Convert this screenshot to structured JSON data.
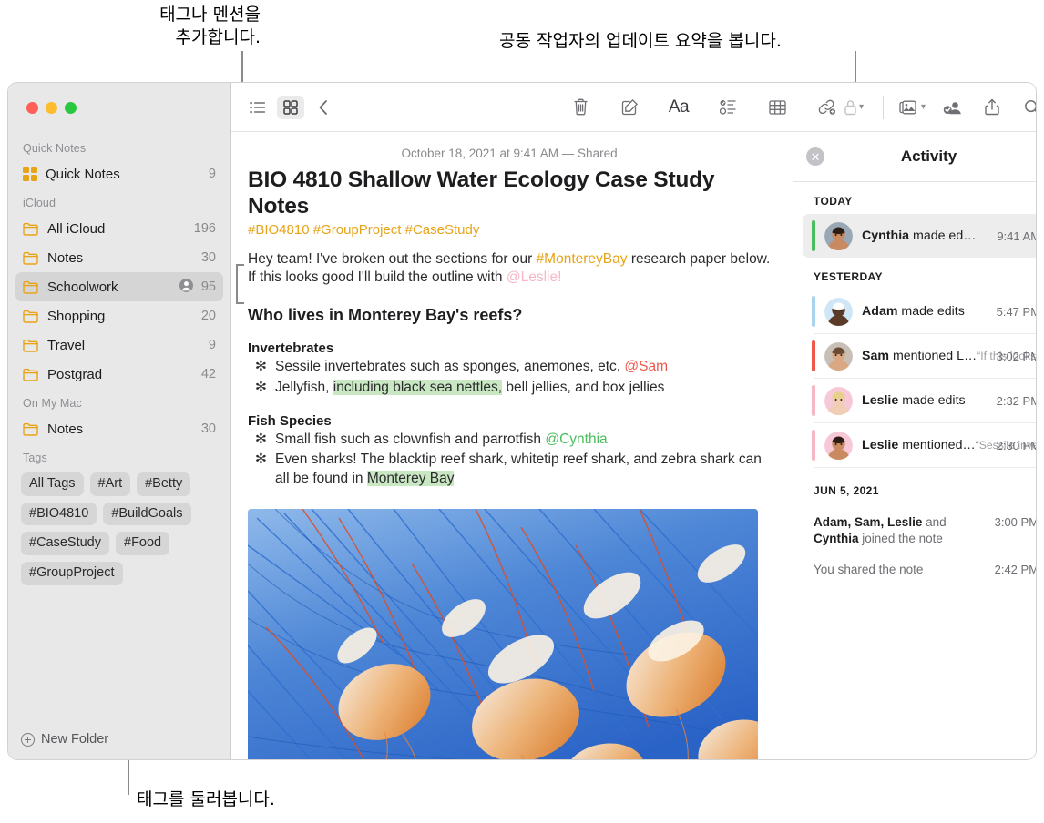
{
  "annotations": {
    "top_left": "태그나 멘션을\n추가합니다.",
    "top_right": "공동 작업자의 업데이트 요약을 봅니다.",
    "bottom_left": "태그를 둘러봅니다."
  },
  "sidebar": {
    "groups": [
      {
        "title": "Quick Notes",
        "items": [
          {
            "label": "Quick Notes",
            "count": "9",
            "icon": "quicknotes-icon",
            "selected": false,
            "shared": false
          }
        ]
      },
      {
        "title": "iCloud",
        "items": [
          {
            "label": "All iCloud",
            "count": "196",
            "icon": "folder-icon",
            "selected": false,
            "shared": false
          },
          {
            "label": "Notes",
            "count": "30",
            "icon": "folder-icon",
            "selected": false,
            "shared": false
          },
          {
            "label": "Schoolwork",
            "count": "95",
            "icon": "folder-icon",
            "selected": true,
            "shared": true
          },
          {
            "label": "Shopping",
            "count": "20",
            "icon": "folder-icon",
            "selected": false,
            "shared": false
          },
          {
            "label": "Travel",
            "count": "9",
            "icon": "folder-icon",
            "selected": false,
            "shared": false
          },
          {
            "label": "Postgrad",
            "count": "42",
            "icon": "folder-icon",
            "selected": false,
            "shared": false
          }
        ]
      },
      {
        "title": "On My Mac",
        "items": [
          {
            "label": "Notes",
            "count": "30",
            "icon": "folder-icon",
            "selected": false,
            "shared": false
          }
        ]
      }
    ],
    "tags_title": "Tags",
    "tags": [
      "All Tags",
      "#Art",
      "#Betty",
      "#BIO4810",
      "#BuildGoals",
      "#CaseStudy",
      "#Food",
      "#GroupProject"
    ],
    "new_folder_label": "New Folder"
  },
  "toolbar": {
    "left": [
      {
        "name": "list-view-icon",
        "label": ""
      },
      {
        "name": "gallery-view-icon",
        "label": "",
        "active": true
      },
      {
        "name": "back-chevron-icon",
        "label": ""
      }
    ],
    "middle": [
      {
        "name": "trash-icon"
      },
      {
        "name": "compose-icon"
      },
      {
        "name": "format-aa-icon",
        "label": "Aa"
      },
      {
        "name": "checklist-icon"
      },
      {
        "name": "table-icon"
      },
      {
        "name": "link-icon"
      }
    ],
    "right": [
      {
        "name": "lock-icon"
      },
      {
        "name": "media-icon"
      },
      {
        "name": "collaborate-icon"
      },
      {
        "name": "share-icon"
      },
      {
        "name": "search-icon"
      }
    ]
  },
  "note": {
    "date_line": "October 18, 2021 at 9:41 AM — Shared",
    "title": "BIO 4810 Shallow Water Ecology Case Study Notes",
    "tags_line": "#BIO4810 #GroupProject #CaseStudy",
    "intro": {
      "part1": "Hey team! I've broken out the sections for our ",
      "tag": "#MontereyBay",
      "part2": " research paper below. If this looks good I'll build the outline with ",
      "mention": "@Leslie!"
    },
    "heading": "Who lives in Monterey Bay's reefs?",
    "sections": [
      {
        "heading": "Invertebrates",
        "bullets": [
          {
            "pre": "Sessile invertebrates such as sponges, anemones, etc. ",
            "mention": "@Sam",
            "mention_color": "red",
            "post": ""
          },
          {
            "pre": "Jellyfish, ",
            "highlight": "including black sea nettles,",
            "post": " bell jellies, and box jellies"
          }
        ]
      },
      {
        "heading": "Fish Species",
        "bullets": [
          {
            "pre": "Small fish such as clownfish and parrotfish ",
            "mention": "@Cynthia",
            "mention_color": "green",
            "post": ""
          },
          {
            "pre": "Even sharks! The blacktip reef shark, whitetip reef shark, and zebra shark can all be found in ",
            "highlight": "Monterey Bay",
            "post": ""
          }
        ]
      }
    ],
    "image_alt": "jellyfish-photo"
  },
  "activity": {
    "title": "Activity",
    "close_label": "✕",
    "sections": [
      {
        "day": "TODAY",
        "items": [
          {
            "name": "Cynthia",
            "action": " made ed…",
            "quote": "",
            "time": "9:41 AM",
            "bar_color": "#4bbd5c",
            "avatar_color": "#9aa8b5",
            "selected": true
          }
        ]
      },
      {
        "day": "YESTERDAY",
        "items": [
          {
            "name": "Adam",
            "action": " made edits",
            "quote": "",
            "time": "5:47 PM",
            "bar_color": "#a8d4ee",
            "avatar_color": "#cfe6f7",
            "selected": false
          },
          {
            "name": "Sam",
            "action": " mentioned L…",
            "quote": "“If this looks good I'll…",
            "time": "3:02 PM",
            "bar_color": "#f0564a",
            "avatar_color": "#c8bfb6",
            "selected": false
          },
          {
            "name": "Leslie",
            "action": " made edits",
            "quote": "",
            "time": "2:32 PM",
            "bar_color": "#f5b8c4",
            "avatar_color": "#f7c9d6",
            "selected": false
          },
          {
            "name": "Leslie",
            "action": " mentioned…",
            "quote": "“Sessile invertebrates…",
            "time": "2:30 PM",
            "bar_color": "#f5b8c4",
            "avatar_color": "#f7c9d6",
            "selected": false
          }
        ]
      }
    ],
    "older": {
      "day": "JUN 5, 2021",
      "items": [
        {
          "names": "Adam, Sam, Leslie",
          "mid": " and ",
          "names2": "Cynthia",
          "tail": " joined the note",
          "time": "3:00 PM"
        },
        {
          "names": "",
          "mid": "",
          "names2": "",
          "tail": "You shared the note",
          "time": "2:42 PM"
        }
      ]
    }
  },
  "colors": {
    "accent_tag": "#e8a317",
    "highlight": "#c9e7c2",
    "mention_red": "#f0564a",
    "mention_green": "#4bbd5c",
    "mention_pink": "#f5b8c4"
  }
}
